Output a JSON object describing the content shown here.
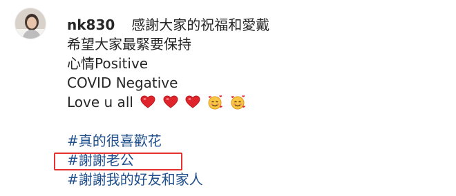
{
  "post": {
    "username": "nk830",
    "caption_lines": [
      "感謝大家的祝福和愛戴",
      "希望大家最緊要保持",
      "心情Positive",
      "COVID Negative",
      "Love u all"
    ],
    "emojis": [
      "red-heart-icon",
      "red-heart-icon",
      "red-heart-icon",
      "smiling-face-with-hearts-icon",
      "smiling-face-with-hearts-icon"
    ],
    "hashtags": [
      "#真的很喜歡花",
      "#謝謝老公",
      "#謝謝我的好友和家人"
    ]
  },
  "colors": {
    "hashtag": "#1f4f8c",
    "highlight_box": "#e5322e",
    "heart": "#e0242c"
  }
}
